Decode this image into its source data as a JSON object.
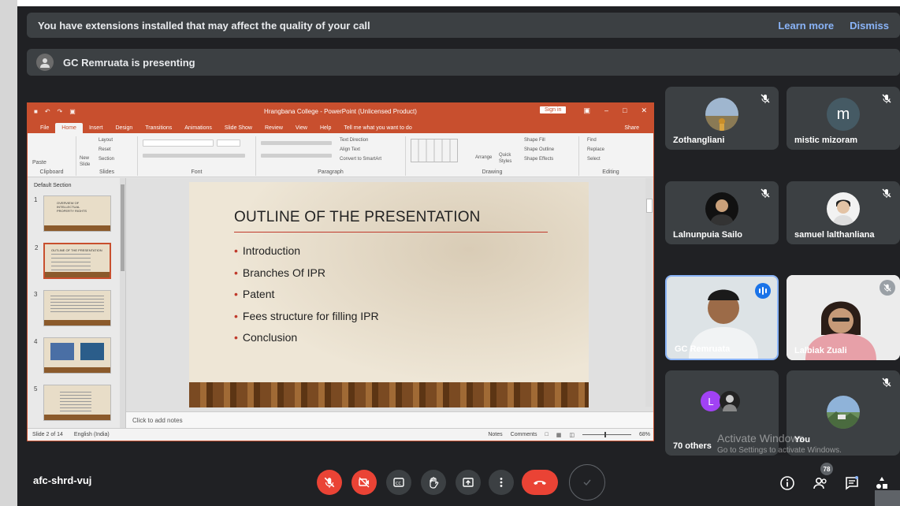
{
  "banner": {
    "message": "You have extensions installed that may affect the quality of your call",
    "learn_more": "Learn more",
    "dismiss": "Dismiss"
  },
  "presenting": {
    "text": "GC Remruata is presenting"
  },
  "powerpoint": {
    "window_title": "Hrangbana College - PowerPoint (Unlicensed Product)",
    "sign_in": "Sign in",
    "tabs": [
      "File",
      "Home",
      "Insert",
      "Design",
      "Transitions",
      "Animations",
      "Slide Show",
      "Review",
      "View",
      "Help",
      "Tell me what you want to do"
    ],
    "share": "Share",
    "ribbon_groups": [
      "Clipboard",
      "Slides",
      "Font",
      "Paragraph",
      "Drawing",
      "Editing"
    ],
    "ribbon_items": {
      "paste": "Paste",
      "new_slide": "New Slide",
      "layout": "Layout",
      "reset": "Reset",
      "section": "Section",
      "text_direction": "Text Direction",
      "align_text": "Align Text",
      "convert_smartart": "Convert to SmartArt",
      "arrange": "Arrange",
      "quick_styles": "Quick Styles",
      "shape_fill": "Shape Fill",
      "shape_outline": "Shape Outline",
      "shape_effects": "Shape Effects",
      "find": "Find",
      "replace": "Replace",
      "select": "Select"
    },
    "section_name": "Default Section",
    "thumbnails": [
      {
        "num": "1",
        "text": "OVERVIEW OF INTELLECTUAL PROPERTY RIGHTS"
      },
      {
        "num": "2",
        "text": "OUTLINE OF THE PRESENTATION"
      },
      {
        "num": "3",
        "text": ""
      },
      {
        "num": "4",
        "text": ""
      },
      {
        "num": "5",
        "text": ""
      }
    ],
    "slide": {
      "title": "OUTLINE OF THE PRESENTATION",
      "bullets": [
        "Introduction",
        "Branches Of IPR",
        "Patent",
        "Fees structure for filling IPR",
        "Conclusion"
      ]
    },
    "notes_placeholder": "Click to add notes",
    "status": {
      "slide_count": "Slide 2 of 14",
      "language": "English (India)",
      "notes": "Notes",
      "comments": "Comments",
      "zoom": "68%"
    }
  },
  "participants": [
    {
      "name": "Zothangliani",
      "muted": true,
      "avatar": "photo"
    },
    {
      "name": "mistic mizoram",
      "muted": true,
      "avatar": "letter",
      "initial": "m",
      "color": "#455a64"
    },
    {
      "name": "Lalnunpuia Sailo",
      "muted": true,
      "avatar": "photo"
    },
    {
      "name": "samuel lalthanliana",
      "muted": true,
      "avatar": "photo"
    },
    {
      "name": "GC Remruata",
      "muted": false,
      "speaking": true,
      "avatar": "video"
    },
    {
      "name": "Lalbiak Zuali",
      "muted": true,
      "avatar": "video"
    },
    {
      "name": "70 others",
      "muted": false,
      "avatar": "group",
      "initial": "L",
      "color": "#a142f4"
    },
    {
      "name": "You",
      "muted": true,
      "avatar": "photo"
    }
  ],
  "watermark": {
    "line1": "Activate Windows",
    "line2": "Go to Settings to activate Windows."
  },
  "bottom_bar": {
    "meeting_code": "afc-shrd-vuj",
    "participant_count": "78",
    "colors": {
      "danger": "#ea4335",
      "surface": "#3c4043",
      "accent": "#8ab4f8"
    },
    "controls": [
      "mic-off-icon",
      "camera-off-icon",
      "captions-icon",
      "raise-hand-icon",
      "present-icon",
      "more-options-icon",
      "end-call-icon",
      "check-icon"
    ],
    "right_controls": [
      "info-icon",
      "people-icon",
      "chat-icon",
      "activities-icon"
    ]
  }
}
